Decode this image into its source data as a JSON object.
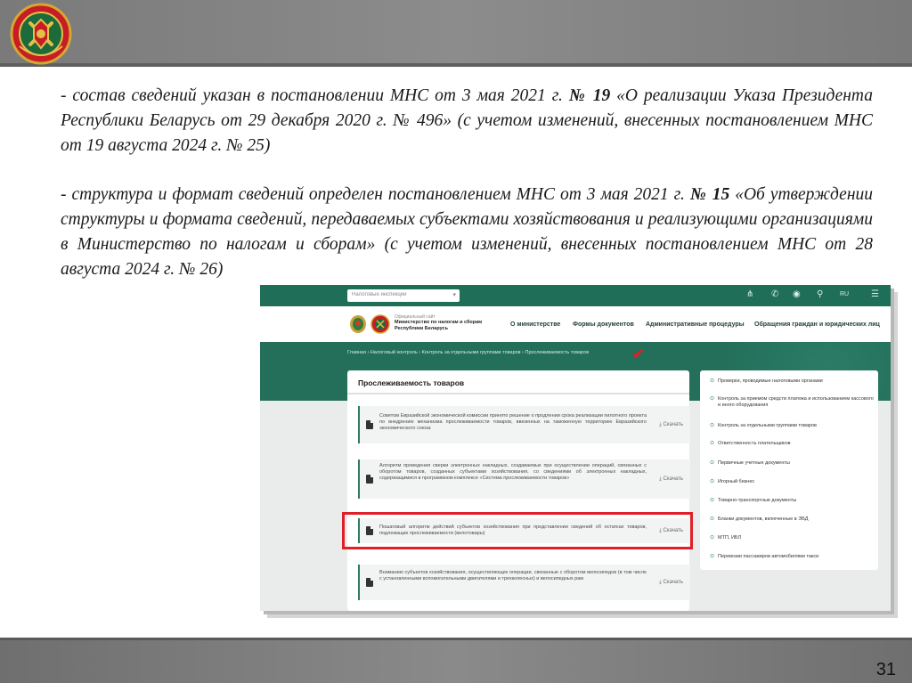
{
  "slide": {
    "number": "31",
    "para1": {
      "t1": "- состав сведений указан в постановлении МНС от 3 мая 2021 г. ",
      "b1": "№ 19",
      "t2": " «О реализации Указа Президента Республики Беларусь от 29 декабря 2020 г. № 496» (с учетом изменений, внесенных постановлением МНС от 19 августа 2024 г. № 25)"
    },
    "para2": {
      "t1": "- структура и формат сведений определен постановлением МНС от 3 мая 2021 г. ",
      "b1": "№ 15",
      "t2": " «Об утверждении структуры и формата сведений, передаваемых субъектами хозяйствования и реализующими организациями в Министерство по налогам и сборам» (с учетом изменений, внесенных постановлением МНС от 28 августа 2024 г. № 26)"
    }
  },
  "website": {
    "search_placeholder": "Налоговые инспекции",
    "lang": "RU",
    "org_small": "Официальный сайт",
    "org_name": "Министерство по налогам и сборам Республики Беларусь",
    "nav": [
      "О министерстве",
      "Формы документов",
      "Административные процедуры",
      "Обращения граждан и юридических лиц"
    ],
    "breadcrumb": "Главная  ›  Налоговый контроль  ›  Контроль за отдельными группами товаров  ›  Прослеживаемость товаров",
    "section_title": "Прослеживаемость товаров",
    "download_label": "⤓ Скачать",
    "documents": [
      "Советом Евразийской экономической комиссии принято решение о продлении срока реализации пилотного проекта по внедрению механизма прослеживаемости товаров, ввезенных на таможенную территорию Евразийского экономического союза",
      "Алгоритм проведения сверки электронных накладных, создаваемых при осуществлении операций, связанных с оборотом товаров, созданных субъектами хозяйствования, со сведениями об электронных накладных, содержащимися в программном комплексе «Система прослеживаемости товаров»",
      "Пошаговый алгоритм действий субъектов хозяйствования при представлении сведений об остатках товаров, подлежащих прослеживаемости (велотовары)",
      "Вниманию субъектов хозяйствования, осуществляющих операции, связанные с оборотом велосипедов (в том числе с установленными вспомогательными двигателями и трехколесных) и велосипедных рам"
    ],
    "sidebar": [
      "Проверки, проводимые налоговыми органами",
      "Контроль за приемом средств платежа и использованием кассового и иного оборудования",
      "Контроль за отдельными группами товаров",
      "Ответственность плательщиков",
      "Первичные учетные документы",
      "Игорный бизнес",
      "Товарно-транспортные документы",
      "Бланки документов, включенные в ЭБД",
      "МТП, ИБЛ",
      "Перевозки пассажиров автомобилями такси"
    ]
  }
}
